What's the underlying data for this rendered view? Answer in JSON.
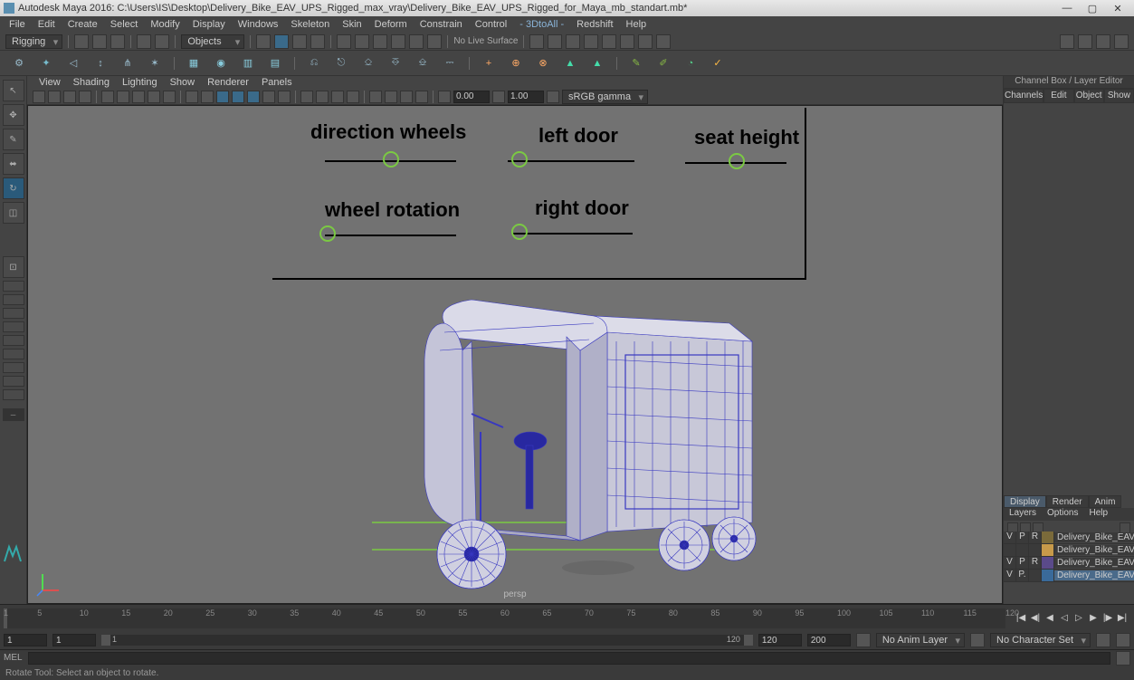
{
  "title": "Autodesk Maya 2016: C:\\Users\\IS\\Desktop\\Delivery_Bike_EAV_UPS_Rigged_max_vray\\Delivery_Bike_EAV_UPS_Rigged_for_Maya_mb_standart.mb*",
  "menus": [
    "File",
    "Edit",
    "Create",
    "Select",
    "Modify",
    "Display",
    "Windows",
    "Skeleton",
    "Skin",
    "Deform",
    "Constrain",
    "Control",
    "- 3DtoAll -",
    "Redshift",
    "Help"
  ],
  "workspace_mode": "Rigging",
  "selection_mode": "Objects",
  "no_live_surface": "No Live Surface",
  "viewport_menus": [
    "View",
    "Shading",
    "Lighting",
    "Show",
    "Renderer",
    "Panels"
  ],
  "vp_field1": "0.00",
  "vp_field2": "1.00",
  "vp_gamma": "sRGB gamma",
  "persp": "persp",
  "controls": {
    "direction_wheels": "direction wheels",
    "left_door": "left door",
    "seat_height": "seat height",
    "wheel_rotation": "wheel rotation",
    "right_door": "right door"
  },
  "channel_box_title": "Channel Box / Layer Editor",
  "channel_tabs": [
    "Channels",
    "Edit",
    "Object",
    "Show"
  ],
  "layer_tabs": [
    "Display",
    "Render",
    "Anim"
  ],
  "layer_subtabs": [
    "Layers",
    "Options",
    "Help"
  ],
  "layers": [
    {
      "v": "V",
      "p": "P",
      "r": "R",
      "color": "#7a6a3a",
      "name": "Delivery_Bike_EAV_UPS"
    },
    {
      "v": "",
      "p": "",
      "r": "",
      "color": "#c79a4a",
      "name": "Delivery_Bike_EAV_UPS"
    },
    {
      "v": "V",
      "p": "P",
      "r": "R",
      "color": "#5a4a8a",
      "name": "Delivery_Bike_EAV_UPS"
    },
    {
      "v": "V",
      "p": "P.",
      "r": "",
      "color": "#3a6a9a",
      "name": "Delivery_Bike_EAV_UPS",
      "selected": true
    }
  ],
  "timeline": {
    "ticks": [
      1,
      5,
      10,
      15,
      20,
      25,
      30,
      35,
      40,
      45,
      50,
      55,
      60,
      65,
      70,
      75,
      80,
      85,
      90,
      95,
      100,
      105,
      110,
      115,
      120
    ]
  },
  "range": {
    "start_outer": "1",
    "start": "1",
    "cur": "1",
    "end": "120",
    "end_outer": "120",
    "max": "200"
  },
  "anim_layer": "No Anim Layer",
  "char_set": "No Character Set",
  "cmd_label": "MEL",
  "help_line": "Rotate Tool: Select an object to rotate."
}
